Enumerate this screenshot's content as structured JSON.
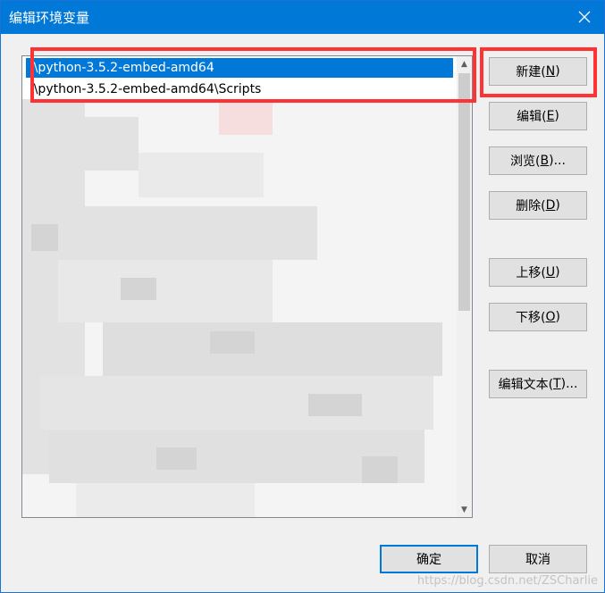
{
  "window": {
    "title": "编辑环境变量",
    "close_icon": "close-icon"
  },
  "list": {
    "items": [
      {
        "text": ":\\python-3.5.2-embed-amd64",
        "selected": true
      },
      {
        "text": ":\\python-3.5.2-embed-amd64\\Scripts",
        "selected": false
      }
    ]
  },
  "buttons": {
    "new": {
      "label": "新建(",
      "key": "N",
      "suffix": ")"
    },
    "edit": {
      "label": "编辑(",
      "key": "E",
      "suffix": ")"
    },
    "browse": {
      "label": "浏览(",
      "key": "B",
      "suffix": ")..."
    },
    "delete": {
      "label": "删除(",
      "key": "D",
      "suffix": ")"
    },
    "move_up": {
      "label": "上移(",
      "key": "U",
      "suffix": ")"
    },
    "move_down": {
      "label": "下移(",
      "key": "O",
      "suffix": ")"
    },
    "edit_text": {
      "label": "编辑文本(",
      "key": "T",
      "suffix": ")..."
    },
    "ok": {
      "label": "确定"
    },
    "cancel": {
      "label": "取消"
    }
  },
  "watermark": "https://blog.csdn.net/ZSCharlie",
  "colors": {
    "titlebar": "#0078d7",
    "selection": "#0078d7",
    "highlight": "#ff3333",
    "button": "#e1e1e1"
  }
}
